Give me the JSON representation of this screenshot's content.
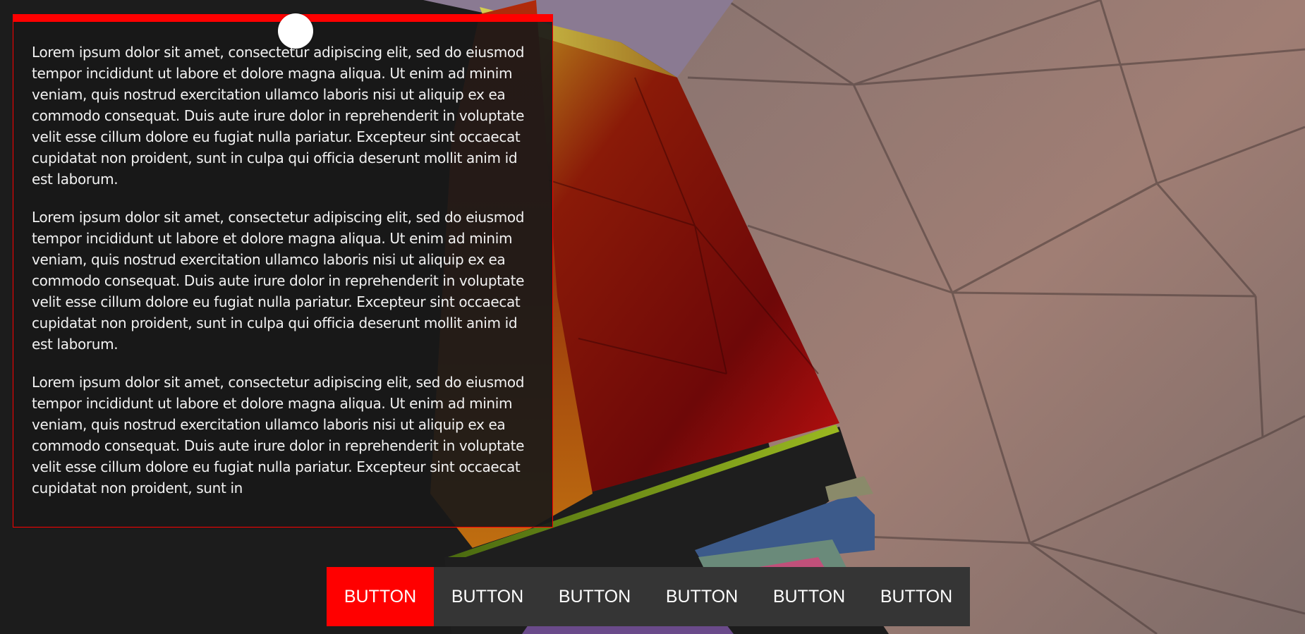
{
  "colors": {
    "accent": "#ff0000",
    "panel": "#181818",
    "button_bar": "#353535",
    "text": "#f2f2f2"
  },
  "slider": {
    "value_fraction": 0.5
  },
  "paragraphs": [
    "Lorem ipsum dolor sit amet, consectetur adipiscing elit, sed do eiusmod tempor incididunt ut labore et dolore magna aliqua. Ut enim ad minim veniam, quis nostrud exercitation ullamco laboris nisi ut aliquip ex ea commodo consequat. Duis aute irure dolor in reprehenderit in voluptate velit esse cillum dolore eu fugiat nulla pariatur. Excepteur sint occaecat cupidatat non proident, sunt in culpa qui officia deserunt mollit anim id est laborum.",
    "Lorem ipsum dolor sit amet, consectetur adipiscing elit, sed do eiusmod tempor incididunt ut labore et dolore magna aliqua. Ut enim ad minim veniam, quis nostrud exercitation ullamco laboris nisi ut aliquip ex ea commodo consequat. Duis aute irure dolor in reprehenderit in voluptate velit esse cillum dolore eu fugiat nulla pariatur. Excepteur sint occaecat cupidatat non proident, sunt in culpa qui officia deserunt mollit anim id est laborum.",
    "Lorem ipsum dolor sit amet, consectetur adipiscing elit, sed do eiusmod tempor incididunt ut labore et dolore magna aliqua. Ut enim ad minim veniam, quis nostrud exercitation ullamco laboris nisi ut aliquip ex ea commodo consequat. Duis aute irure dolor in reprehenderit in voluptate velit esse cillum dolore eu fugiat nulla pariatur. Excepteur sint occaecat cupidatat non proident, sunt in"
  ],
  "buttons": [
    {
      "label": "BUTTON",
      "active": true
    },
    {
      "label": "BUTTON",
      "active": false
    },
    {
      "label": "BUTTON",
      "active": false
    },
    {
      "label": "BUTTON",
      "active": false
    },
    {
      "label": "BUTTON",
      "active": false
    },
    {
      "label": "BUTTON",
      "active": false
    }
  ]
}
